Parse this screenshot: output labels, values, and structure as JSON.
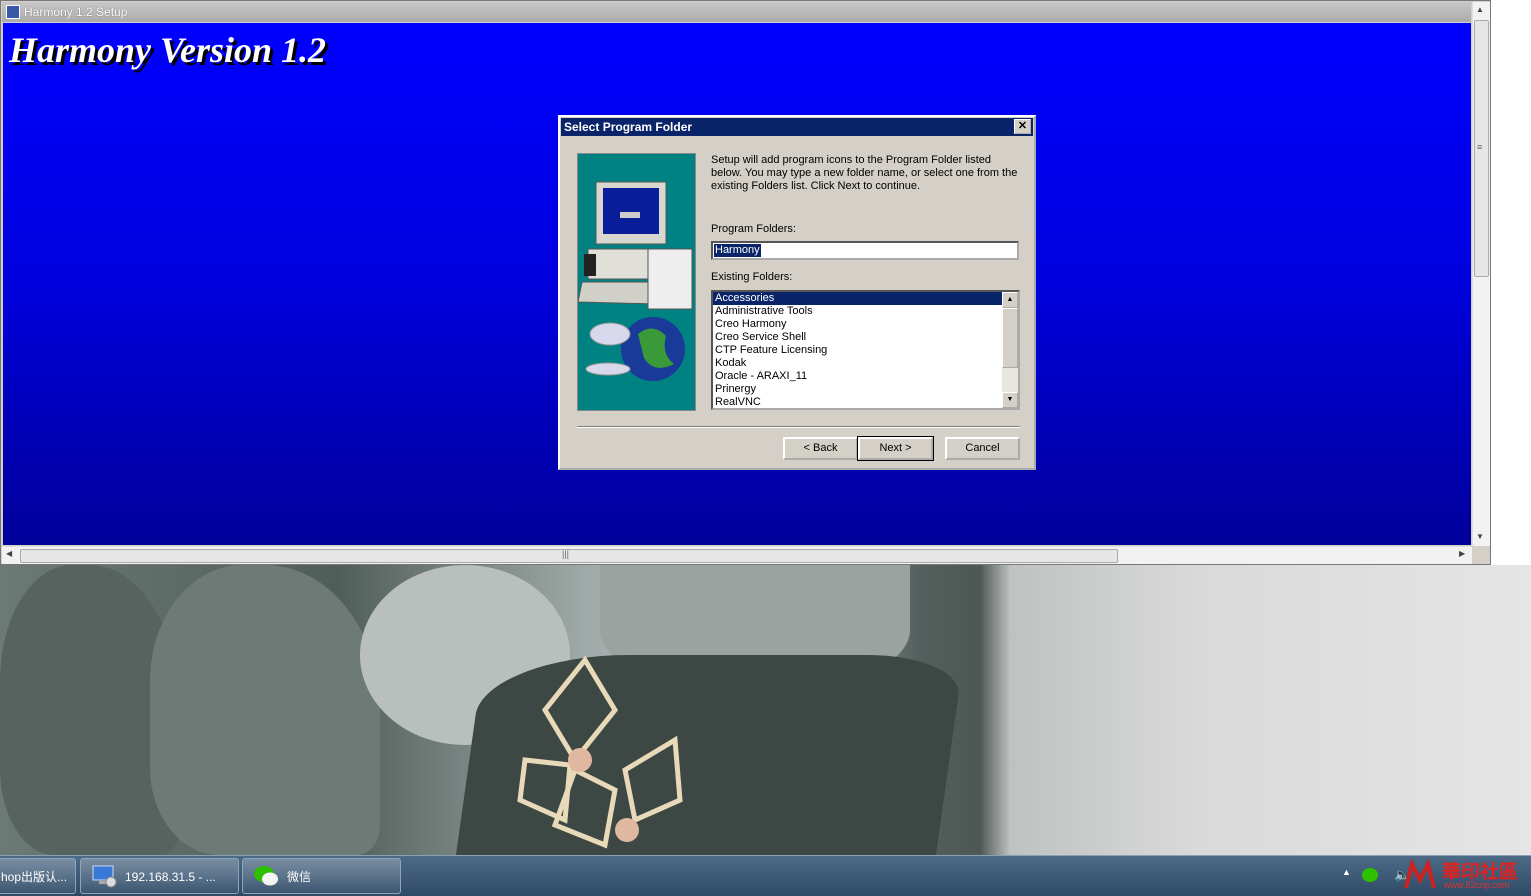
{
  "window": {
    "title": "Harmony 1.2 Setup",
    "banner": "Harmony Version 1.2"
  },
  "dialog": {
    "title": "Select Program Folder",
    "close": "✕",
    "intro": "Setup will add program icons to the Program Folder listed below. You may type a new folder name, or select one from the existing Folders list.  Click Next to continue.",
    "program_folders_label": "Program Folders:",
    "program_folder_value": "Harmony",
    "existing_folders_label": "Existing Folders:",
    "existing_folders": [
      "Accessories",
      "Administrative Tools",
      "Creo Harmony",
      "Creo Service Shell",
      "CTP Feature Licensing",
      "Kodak",
      "Oracle - ARAXI_11",
      "Prinergy",
      "RealVNC"
    ],
    "selected_folder": "Accessories",
    "buttons": {
      "back": "< Back",
      "next": "Next >",
      "cancel": "Cancel"
    }
  },
  "taskbar": {
    "items": [
      {
        "label": "hop出版认..."
      },
      {
        "label": "192.168.31.5 - ..."
      },
      {
        "label": "微信"
      }
    ],
    "tray_up": "▲",
    "volume": "🔈"
  },
  "watermark": {
    "text": "華印社區",
    "sub": "www.52cnp.com"
  },
  "colors": {
    "banner_top": "#0000ff",
    "banner_bottom": "#00009a",
    "dialog_title": "#0a246a",
    "dialog_face": "#d4d0c8",
    "art_teal": "#008282"
  }
}
